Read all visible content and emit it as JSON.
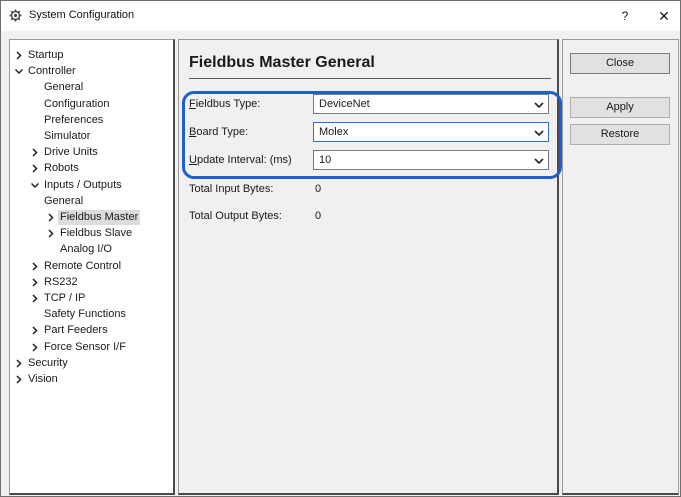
{
  "window": {
    "title": "System Configuration",
    "help_label": "?",
    "close_label": "✕",
    "icon": "gear-icon"
  },
  "tree": {
    "items": [
      {
        "label": "Startup",
        "expander": "collapsed"
      },
      {
        "label": "Controller",
        "expander": "expanded"
      },
      {
        "label": "General",
        "expander": "none"
      },
      {
        "label": "Configuration",
        "expander": "none"
      },
      {
        "label": "Preferences",
        "expander": "none"
      },
      {
        "label": "Simulator",
        "expander": "none"
      },
      {
        "label": "Drive Units",
        "expander": "collapsed"
      },
      {
        "label": "Robots",
        "expander": "collapsed"
      },
      {
        "label": "Inputs / Outputs",
        "expander": "expanded"
      },
      {
        "label": "General",
        "expander": "none"
      },
      {
        "label": "Fieldbus Master",
        "expander": "collapsed",
        "selected": true
      },
      {
        "label": "Fieldbus Slave",
        "expander": "collapsed"
      },
      {
        "label": "Analog I/O",
        "expander": "none"
      },
      {
        "label": "Remote Control",
        "expander": "collapsed"
      },
      {
        "label": "RS232",
        "expander": "collapsed"
      },
      {
        "label": "TCP / IP",
        "expander": "collapsed"
      },
      {
        "label": "Safety Functions",
        "expander": "none"
      },
      {
        "label": "Part Feeders",
        "expander": "collapsed"
      },
      {
        "label": "Force Sensor I/F",
        "expander": "collapsed"
      },
      {
        "label": "Security",
        "expander": "collapsed"
      },
      {
        "label": "Vision",
        "expander": "collapsed"
      }
    ]
  },
  "main": {
    "title": "Fieldbus Master General",
    "fields": [
      {
        "label_accel": "F",
        "label_rest": "ieldbus Type:",
        "value": "DeviceNet"
      },
      {
        "label_accel": "B",
        "label_rest": "oard Type:",
        "value": "Molex"
      },
      {
        "label_accel": "U",
        "label_rest": "pdate Interval: (ms)",
        "value": "10"
      }
    ],
    "info": [
      {
        "label": "Total Input Bytes:",
        "value": "0"
      },
      {
        "label": "Total Output Bytes:",
        "value": "0"
      }
    ]
  },
  "buttons": {
    "close": "Close",
    "apply": "Apply",
    "restore": "Restore"
  },
  "colors": {
    "highlight_ring": "#1e5fd0",
    "selected_bg": "#dcdcdc"
  }
}
